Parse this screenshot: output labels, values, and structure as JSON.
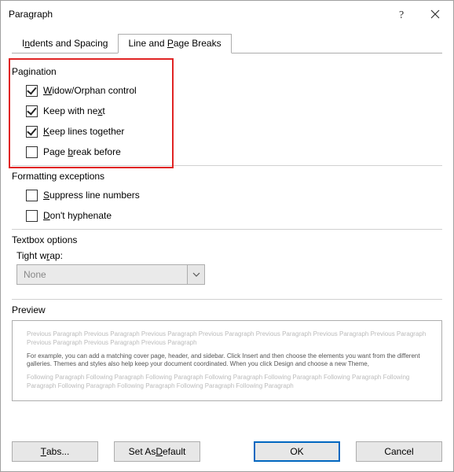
{
  "window": {
    "title": "Paragraph"
  },
  "tabs": {
    "indents": "Indents and Spacing",
    "linepage": "Line and Page Breaks"
  },
  "pagination": {
    "label": "Pagination",
    "widow": "Widow/Orphan control",
    "keepnext": "Keep with next",
    "keeplines": "Keep lines together",
    "pagebreak": "Page break before"
  },
  "formatting": {
    "label": "Formatting exceptions",
    "suppress": "Suppress line numbers",
    "dont": "Don't hyphenate"
  },
  "textbox": {
    "label": "Textbox options",
    "tight": "Tight wrap:",
    "value": "None"
  },
  "preview": {
    "label": "Preview",
    "prev_repeat": "Previous Paragraph Previous Paragraph Previous Paragraph Previous Paragraph Previous Paragraph Previous Paragraph Previous Paragraph Previous Paragraph Previous Paragraph Previous Paragraph",
    "sample": "For example, you can add a matching cover page, header, and sidebar. Click Insert and then choose the elements you want from the different galleries. Themes and styles also help keep your document coordinated. When you click Design and choose a new Theme,",
    "next_repeat": "Following Paragraph Following Paragraph Following Paragraph Following Paragraph Following Paragraph Following Paragraph Following Paragraph Following Paragraph Following Paragraph Following Paragraph Following Paragraph"
  },
  "buttons": {
    "tabs": "Tabs...",
    "setdefault": "Set As Default",
    "ok": "OK",
    "cancel": "Cancel"
  }
}
